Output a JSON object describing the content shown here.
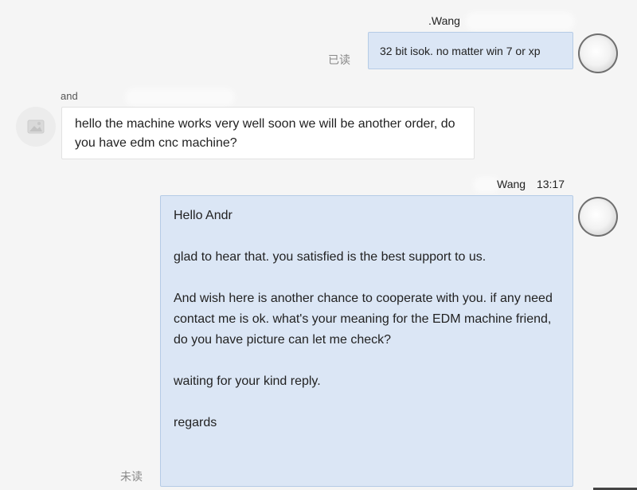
{
  "messages": [
    {
      "sender": "Wang",
      "sender_prefix": ".",
      "time": "",
      "text": "32 bit isok. no matter win 7 or xp",
      "status": "已读"
    },
    {
      "sender": "and",
      "time": "",
      "text": "hello the machine works very well soon we will be another order, do you have edm cnc machine?"
    },
    {
      "sender": "Wang",
      "time": "13:17",
      "greeting": "Hello Andr",
      "paragraphs": [
        "glad to hear that. you satisfied is the best support to us.",
        "And wish here is another chance to cooperate with you. if any need contact me is ok. what's your meaning for the EDM machine friend, do you have picture can let me check?",
        "waiting for your kind reply.",
        "regards"
      ],
      "status": "未读"
    }
  ],
  "icons": {
    "my_avatar": "avatar-icon",
    "contact_avatar": "image-placeholder-icon"
  }
}
